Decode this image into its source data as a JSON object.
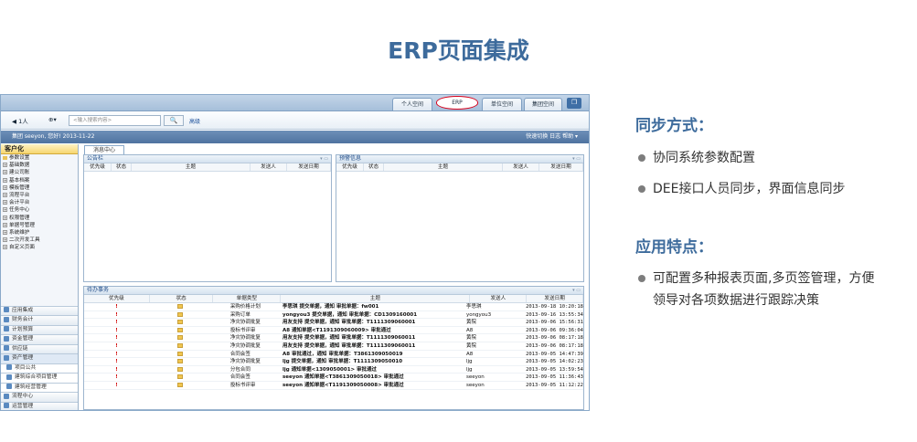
{
  "slide_title": "ERP页面集成",
  "right": {
    "sync_title": "同步方式：",
    "sync_items": [
      "协同系统参数配置",
      "DEE接口人员同步，界面信息同步"
    ],
    "feature_title": "应用特点：",
    "feature_lines": [
      "可配置多种报表页面,多页签管理，方便",
      "领导对各项数据进行跟踪决策"
    ]
  },
  "screenshot": {
    "tabs": [
      "个人空间",
      "ERP",
      "单位空间",
      "集团空间"
    ],
    "toolbar": {
      "back": "◀ 1人",
      "forward": "⊕▾",
      "search_placeholder": "<输入搜索内容>",
      "search_btn": "🔍",
      "advanced": "高级"
    },
    "userbar": {
      "left": "集团 seeyon, 您好! 2013-11-22",
      "right": "快速切换  日志  帮助 ▾"
    },
    "sidebar": {
      "header": "客户化",
      "tree": [
        "参数设置",
        "基础数据",
        "建公司账",
        "基本档案",
        "模板管理",
        "流程平台",
        "会计平台",
        "任务中心",
        "权限管理",
        "单据号管理",
        "系统维护",
        "二次开发工具",
        "自定义页面"
      ],
      "modules": [
        "应用集成",
        "财务会计",
        "计划预算",
        "资金管理",
        "供应链",
        "资产管理",
        "项目公共",
        "建筑综合项目管理",
        "建筑经营管理",
        "流程中心",
        "运营管理"
      ]
    },
    "main_tab": "消息中心",
    "notice": {
      "title": "公告栏",
      "columns": [
        "优先级",
        "状态",
        "主题",
        "发送人",
        "发送日期"
      ]
    },
    "alert": {
      "title": "预警信息",
      "columns": [
        "优先级",
        "状态",
        "主题",
        "发送人",
        "发送日期"
      ]
    },
    "todo": {
      "title": "待办事务",
      "columns": [
        "优先级",
        "状态",
        "单据类型",
        "主题",
        "发送人",
        "发送日期"
      ],
      "rows": [
        {
          "pri": "!",
          "type": "采购价格计划",
          "subject": "李思琪 提交单据，通知 审批单据：fw001",
          "sender": "李思琪",
          "date": "2013-09-18 10:20:18"
        },
        {
          "pri": "!",
          "type": "采购订单",
          "subject": "yongyou3 提交单据，通知 审批单据：CD1309160001",
          "sender": "yongyou3",
          "date": "2013-09-16 13:55:34"
        },
        {
          "pri": "!",
          "type": "净灾协调批复",
          "subject": "用友支持 提交单据，通知 审批单据：T1111309060001",
          "sender": "黄院",
          "date": "2013-09-06 15:56:31"
        },
        {
          "pri": "!",
          "type": "投标书评审",
          "subject": "A8 通知单据<T1191309060009> 审批通过",
          "sender": "A8",
          "date": "2013-09-06 09:36:04"
        },
        {
          "pri": "!",
          "type": "净灾协调批复",
          "subject": "用友支持 提交单据，通知 审批单据：T1111309060011",
          "sender": "黄院",
          "date": "2013-09-06 08:17:18"
        },
        {
          "pri": "!",
          "type": "净灾协调批复",
          "subject": "用友支持 提交单据，通知 审批单据：T1111309060011",
          "sender": "黄院",
          "date": "2013-09-06 08:17:18"
        },
        {
          "pri": "!",
          "type": "合同会签",
          "subject": "A8 审批通过，通知 审批单据：T3861309050019",
          "sender": "A8",
          "date": "2013-09-05 14:47:39"
        },
        {
          "pri": "!",
          "type": "净灾协调批复",
          "subject": "ljg 提交单据，通知 审批单据：T1111309050010",
          "sender": "ljg",
          "date": "2013-09-05 14:02:23"
        },
        {
          "pri": "!",
          "type": "分包合同",
          "subject": "ljg 通知单据<1309050001> 审批通过",
          "sender": "ljg",
          "date": "2013-09-05 13:59:54"
        },
        {
          "pri": "!",
          "type": "合同会签",
          "subject": "seeyon 通知单据<T3861309050018> 审批通过",
          "sender": "seeyon",
          "date": "2013-09-05 11:36:43"
        },
        {
          "pri": "!",
          "type": "投标书评审",
          "subject": "seeyon 通知单据<T1191309050008> 审批通过",
          "sender": "seeyon",
          "date": "2013-09-05 11:12:22"
        }
      ]
    }
  }
}
